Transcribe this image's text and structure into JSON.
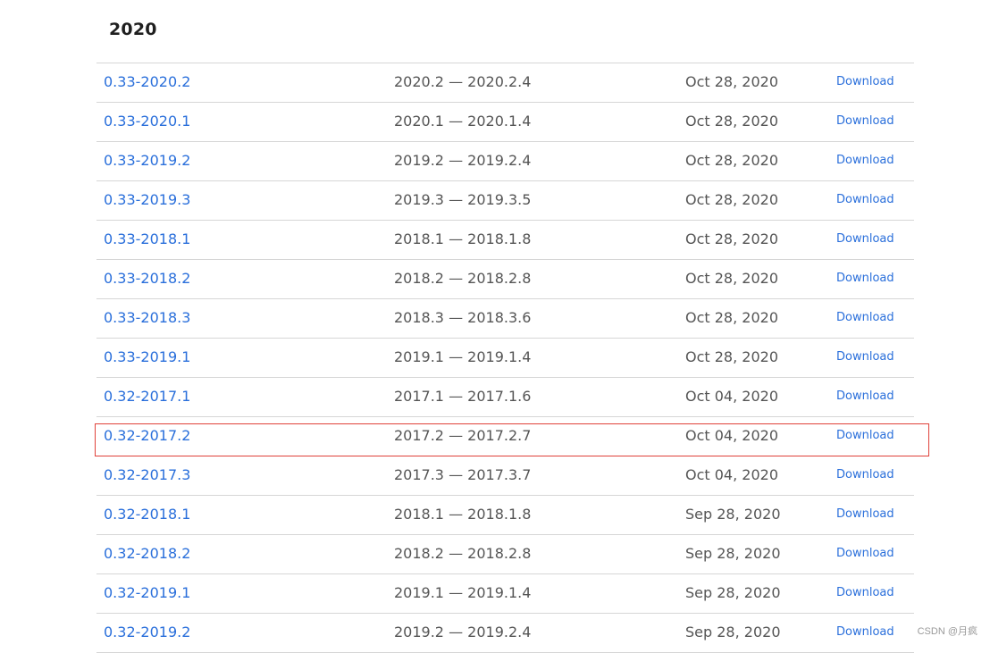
{
  "section": {
    "title": "2020"
  },
  "table": {
    "rows": [
      {
        "version": "0.33-2020.2",
        "range": "2020.2 — 2020.2.4",
        "date": "Oct 28, 2020",
        "download": "Download"
      },
      {
        "version": "0.33-2020.1",
        "range": "2020.1 — 2020.1.4",
        "date": "Oct 28, 2020",
        "download": "Download"
      },
      {
        "version": "0.33-2019.2",
        "range": "2019.2 — 2019.2.4",
        "date": "Oct 28, 2020",
        "download": "Download"
      },
      {
        "version": "0.33-2019.3",
        "range": "2019.3 — 2019.3.5",
        "date": "Oct 28, 2020",
        "download": "Download"
      },
      {
        "version": "0.33-2018.1",
        "range": "2018.1 — 2018.1.8",
        "date": "Oct 28, 2020",
        "download": "Download"
      },
      {
        "version": "0.33-2018.2",
        "range": "2018.2 — 2018.2.8",
        "date": "Oct 28, 2020",
        "download": "Download"
      },
      {
        "version": "0.33-2018.3",
        "range": "2018.3 — 2018.3.6",
        "date": "Oct 28, 2020",
        "download": "Download"
      },
      {
        "version": "0.33-2019.1",
        "range": "2019.1 — 2019.1.4",
        "date": "Oct 28, 2020",
        "download": "Download"
      },
      {
        "version": "0.32-2017.1",
        "range": "2017.1 — 2017.1.6",
        "date": "Oct 04, 2020",
        "download": "Download"
      },
      {
        "version": "0.32-2017.2",
        "range": "2017.2 — 2017.2.7",
        "date": "Oct 04, 2020",
        "download": "Download"
      },
      {
        "version": "0.32-2017.3",
        "range": "2017.3 — 2017.3.7",
        "date": "Oct 04, 2020",
        "download": "Download"
      },
      {
        "version": "0.32-2018.1",
        "range": "2018.1 — 2018.1.8",
        "date": "Sep 28, 2020",
        "download": "Download"
      },
      {
        "version": "0.32-2018.2",
        "range": "2018.2 — 2018.2.8",
        "date": "Sep 28, 2020",
        "download": "Download"
      },
      {
        "version": "0.32-2019.1",
        "range": "2019.1 — 2019.1.4",
        "date": "Sep 28, 2020",
        "download": "Download"
      },
      {
        "version": "0.32-2019.2",
        "range": "2019.2 — 2019.2.4",
        "date": "Sep 28, 2020",
        "download": "Download"
      }
    ]
  },
  "highlight": {
    "row_index": 9,
    "color": "#e0413a"
  },
  "watermark": {
    "text": "CSDN @月疯"
  },
  "colors": {
    "link": "#2a6fdb",
    "text": "#555555",
    "divider": "#d6d6d6"
  }
}
